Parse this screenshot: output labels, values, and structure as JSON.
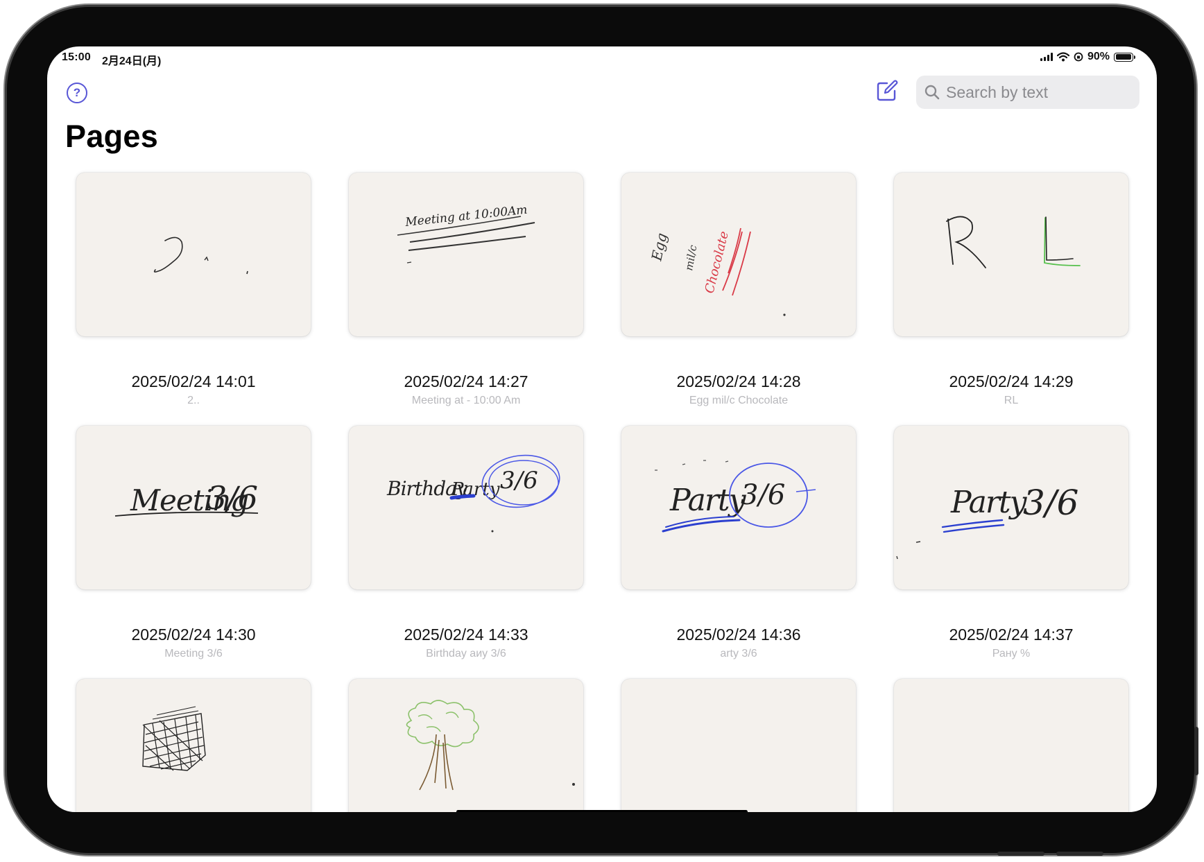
{
  "status_bar": {
    "time": "15:00",
    "date": "2月24日(月)",
    "battery_text": "90%",
    "battery_level": 0.9
  },
  "nav": {
    "help_icon": "question-circle-icon",
    "compose_icon": "square-pencil-icon",
    "search_placeholder": "Search by text",
    "accent_color": "#5856d6"
  },
  "page_title": "Pages",
  "pages": [
    {
      "date": "2025/02/24 14:01",
      "preview_text": "2.."
    },
    {
      "date": "2025/02/24 14:27",
      "preview_text": "Meeting at - 10:00 Am"
    },
    {
      "date": "2025/02/24 14:28",
      "preview_text": "Egg mil/c Chocolate"
    },
    {
      "date": "2025/02/24 14:29",
      "preview_text": "RL"
    },
    {
      "date": "2025/02/24 14:30",
      "preview_text": "Meeting 3/6"
    },
    {
      "date": "2025/02/24 14:33",
      "preview_text": "Birthday аиу 3/6"
    },
    {
      "date": "2025/02/24 14:36",
      "preview_text": "arty 3/6"
    },
    {
      "date": "2025/02/24 14:37",
      "preview_text": "Рану %"
    },
    {
      "date": "",
      "preview_text": ""
    },
    {
      "date": "",
      "preview_text": ""
    },
    {
      "date": "",
      "preview_text": ""
    },
    {
      "date": "",
      "preview_text": ""
    }
  ]
}
